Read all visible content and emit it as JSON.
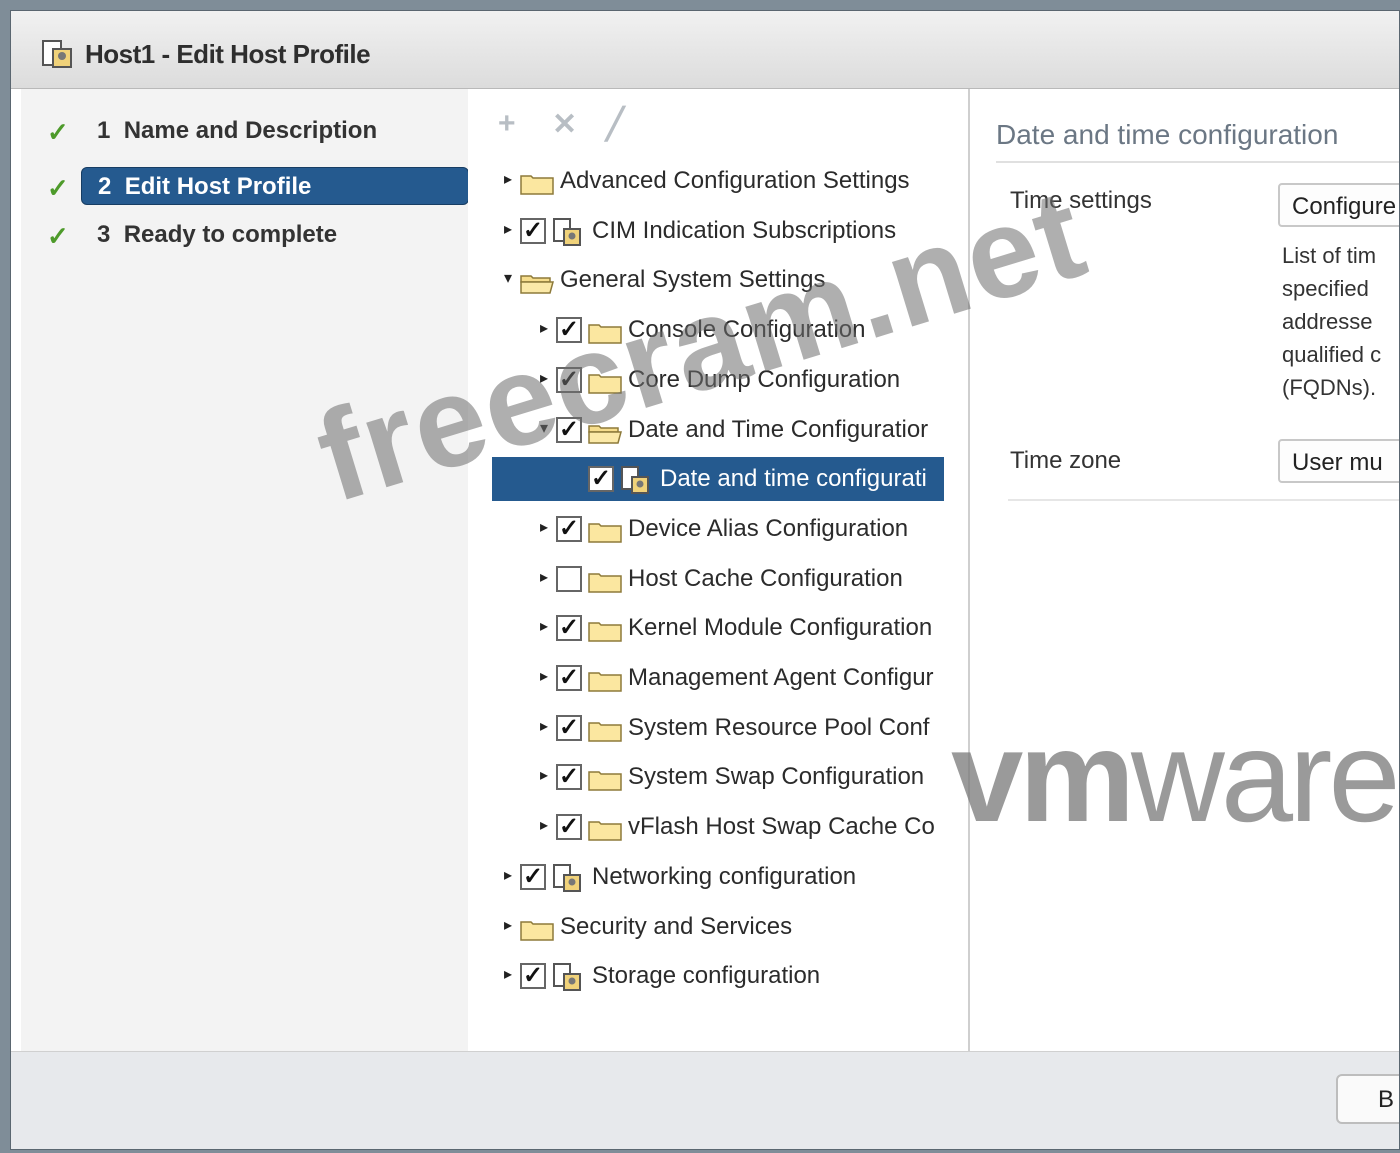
{
  "window": {
    "title": "Host1 - Edit Host Profile",
    "icon": "host-profile-icon"
  },
  "steps": [
    {
      "number": "1",
      "label": "Name and Description",
      "done": true
    },
    {
      "number": "2",
      "label": "Edit Host Profile",
      "done": true,
      "active": true
    },
    {
      "number": "3",
      "label": "Ready to complete",
      "done": true
    }
  ],
  "toolbar": {
    "add_icon": "plus-icon",
    "delete_icon": "x-icon",
    "edit_icon": "pencil-icon"
  },
  "tree": [
    {
      "label": "Advanced Configuration Settings",
      "checked": null,
      "icon": "folder"
    },
    {
      "label": "CIM Indication Subscriptions",
      "checked": true,
      "icon": "host-profile"
    },
    {
      "label": "General System Settings",
      "checked": null,
      "icon": "folder-open"
    },
    {
      "label": "Console Configuration",
      "checked": true,
      "icon": "folder"
    },
    {
      "label": "Core Dump Configuration",
      "checked": true,
      "icon": "folder"
    },
    {
      "label": "Date and Time Configuratior",
      "checked": true,
      "icon": "folder-open"
    },
    {
      "label": "Date and time configurati",
      "checked": true,
      "icon": "host-profile",
      "selected": true
    },
    {
      "label": "Device Alias Configuration",
      "checked": true,
      "icon": "folder"
    },
    {
      "label": "Host Cache Configuration",
      "checked": false,
      "icon": "folder"
    },
    {
      "label": "Kernel Module Configuration",
      "checked": true,
      "icon": "folder"
    },
    {
      "label": "Management Agent Configur",
      "checked": true,
      "icon": "folder"
    },
    {
      "label": "System Resource Pool Conf",
      "checked": true,
      "icon": "folder"
    },
    {
      "label": "System Swap Configuration",
      "checked": true,
      "icon": "folder"
    },
    {
      "label": "vFlash Host Swap Cache Co",
      "checked": true,
      "icon": "folder"
    },
    {
      "label": "Networking configuration",
      "checked": true,
      "icon": "host-profile"
    },
    {
      "label": "Security and Services",
      "checked": null,
      "icon": "folder"
    },
    {
      "label": "Storage configuration",
      "checked": true,
      "icon": "host-profile"
    }
  ],
  "detail": {
    "title": "Date and time configuration",
    "time_settings_label": "Time settings",
    "time_settings_value": "Configure",
    "description_lines": [
      "List of tim",
      "specified",
      "addresse",
      "qualified c",
      "(FQDNs)."
    ],
    "time_zone_label": "Time zone",
    "time_zone_value": "User mu"
  },
  "footer": {
    "button_label": "B"
  },
  "watermarks": {
    "site": "freecram.net",
    "brand_bold": "vm",
    "brand_rest": "ware"
  },
  "colors": {
    "selection": "#255a8f",
    "check_green": "#4d9a2a",
    "folder_yellow": "#f5d77a"
  }
}
